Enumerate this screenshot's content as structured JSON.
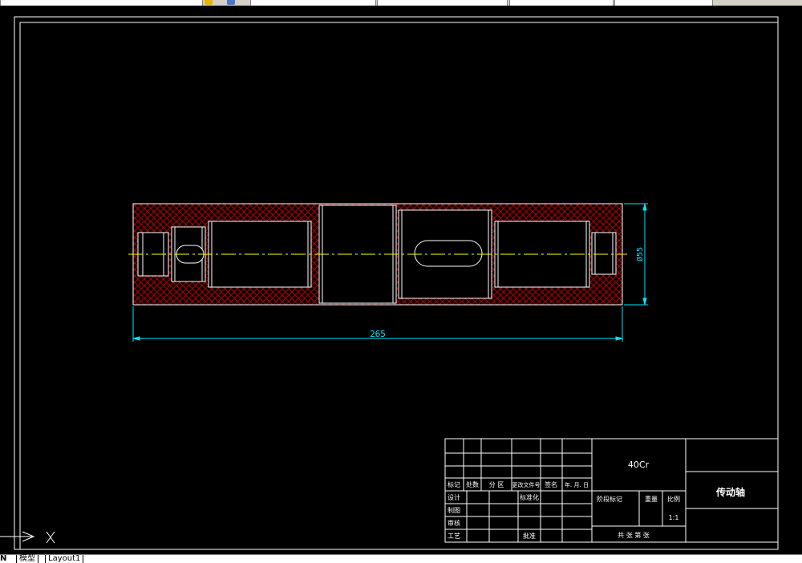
{
  "toolbar": {
    "field_1": "",
    "field_2": "",
    "field_3": "",
    "field_4": "",
    "field_5": ""
  },
  "drawing": {
    "length_dimension": "265",
    "diameter_dimension": "Ø55",
    "colors": {
      "hatch": "#a00000",
      "outline": "#ffffff",
      "centerline": "#ffff00",
      "dimension": "#00e5ff",
      "background": "#000000"
    }
  },
  "title_block": {
    "material": "40Cr",
    "part_name": "传动轴",
    "row_labels": {
      "mark": "标记",
      "count": "处数",
      "zone": "分 区",
      "change_doc": "更改文件号",
      "signature": "签名",
      "date": "年. 月. 日"
    },
    "design": "设计",
    "standardization": "标准化",
    "drafting": "制图",
    "review": "审核",
    "process": "工艺",
    "approve": "批准",
    "stage_mark": "阶段标记",
    "weight": "重量",
    "scale_label": "比例",
    "scale_value": "1:1",
    "sheets": "共  张  第  张"
  },
  "layout_tabs": {
    "nav": "N",
    "model": "模型",
    "layout1": "Layout1"
  }
}
